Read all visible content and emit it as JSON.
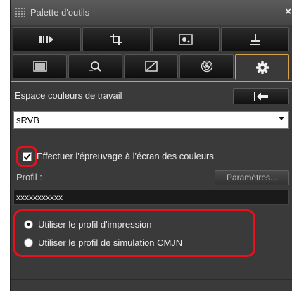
{
  "window": {
    "title": "Palette d'outils",
    "close_glyph": "×"
  },
  "tabs_row1": [
    {
      "icon": "adjust-levels-icon"
    },
    {
      "icon": "crop-icon"
    },
    {
      "icon": "dust-removal-icon"
    },
    {
      "icon": "stamp-icon"
    }
  ],
  "tabs_row2": [
    {
      "icon": "picture-style-icon"
    },
    {
      "icon": "lens-correction-icon"
    },
    {
      "icon": "tone-curve-icon"
    },
    {
      "icon": "color-adjust-icon"
    },
    {
      "icon": "settings-gear-icon",
      "active": true
    }
  ],
  "working_space": {
    "label": "Espace couleurs de travail",
    "reset_icon": "reset-arrow-icon",
    "selected": "sRVB"
  },
  "soft_proof": {
    "checkbox_label": "Effectuer l'épreuvage à l'écran des couleurs",
    "checked": true,
    "profile_label": "Profil :",
    "params_button": "Paramètres...",
    "profile_value": "xxxxxxxxxxx"
  },
  "radios": [
    {
      "label": "Utiliser le profil d'impression",
      "checked": true
    },
    {
      "label": "Utiliser le profil de simulation CMJN",
      "checked": false
    }
  ],
  "colors": {
    "accent": "#d8a24a",
    "highlight_red": "#e8101c",
    "panel_bg": "#3a3a3a"
  }
}
